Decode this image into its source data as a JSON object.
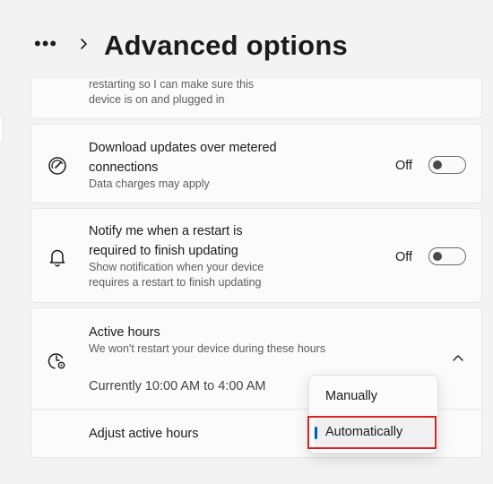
{
  "header": {
    "title": "Advanced options",
    "more_glyph": "•••"
  },
  "cards": {
    "restart_partial": {
      "line1": "restarting so I can make sure this",
      "line2": "device is on and plugged in"
    },
    "metered": {
      "icon": "gauge-icon",
      "title_line1": "Download updates over metered",
      "title_line2": "connections",
      "subtitle": "Data charges may apply",
      "toggle_label": "Off",
      "toggle_on": false
    },
    "notify": {
      "icon": "bell-icon",
      "title_line1": "Notify me when a restart is",
      "title_line2": "required to finish updating",
      "subtitle_line1": "Show notification when your device",
      "subtitle_line2": "requires a restart to finish updating",
      "toggle_label": "Off",
      "toggle_on": false
    },
    "active_hours": {
      "icon": "clock-settings-icon",
      "title": "Active hours",
      "subtitle": "We won't restart your device during these hours",
      "current": "Currently 10:00 AM to 4:00 AM",
      "adjust_label": "Adjust active hours",
      "expanded": true
    }
  },
  "dropdown": {
    "options": [
      "Manually",
      "Automatically"
    ],
    "selected": "Automatically"
  },
  "colors": {
    "accent": "#005fb8",
    "highlight": "#d9211e"
  }
}
